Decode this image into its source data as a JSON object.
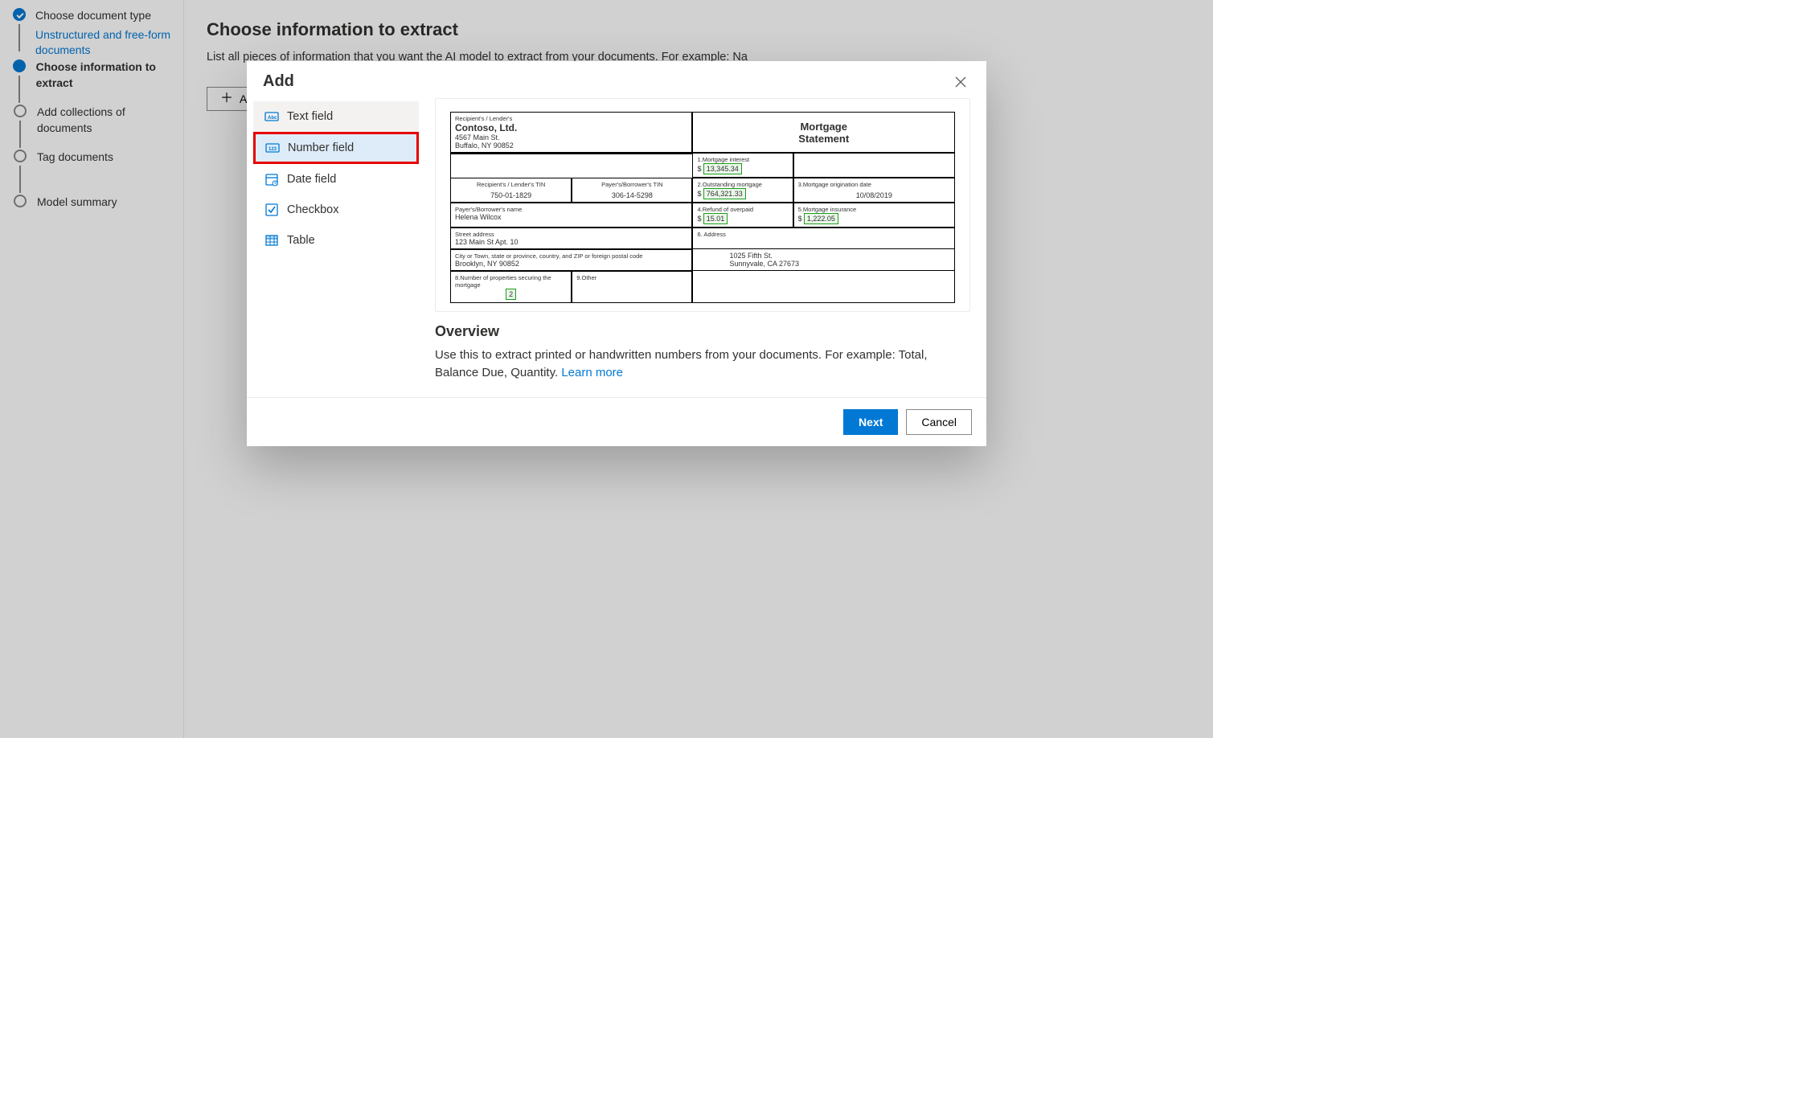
{
  "steps": {
    "s1_label": "Choose document type",
    "s1_sub": "Unstructured and free-form documents",
    "s2_label": "Choose information to extract",
    "s3_label": "Add collections of documents",
    "s4_label": "Tag documents",
    "s5_label": "Model summary"
  },
  "main": {
    "title": "Choose information to extract",
    "description": "List all pieces of information that you want the AI model to extract from your documents. For example: Na",
    "add_button": "Add"
  },
  "dialog": {
    "title": "Add",
    "types": {
      "text": "Text field",
      "number": "Number field",
      "date": "Date field",
      "checkbox": "Checkbox",
      "table": "Table"
    },
    "overview_heading": "Overview",
    "overview_text": "Use this to extract printed or handwritten numbers from your documents. For example: Total, Balance Due, Quantity. ",
    "learn_more": "Learn more",
    "next": "Next",
    "cancel": "Cancel"
  },
  "preview": {
    "recipient_lender_label": "Recipient's / Lender's",
    "company": "Contoso, Ltd.",
    "addr1": "4567 Main St.",
    "addr2": "Buffalo, NY 90852",
    "title_l1": "Mortgage",
    "title_l2": "Statement",
    "f1_label": "1.Mortgage interest",
    "f1_val": "13,345.34",
    "tin_lender_label": "Recipient's / Lender's TIN",
    "tin_lender_val": "750-01-1829",
    "tin_payer_label": "Payer's/Borrower's TIN",
    "tin_payer_val": "306-14-5298",
    "f2_label": "2.Outstanding mortgage",
    "f2_val": "764,321.33",
    "f3_label": "3.Mortgage origination date",
    "f3_val": "10/08/2019",
    "borrower_name_label": "Payer's/Borrower's name",
    "borrower_name": "Helena Wilcox",
    "f4_label": "4.Refund of overpaid",
    "f4_val": "15.01",
    "f5_label": "5.Mortgage insurance",
    "f5_val": "1,222.05",
    "street_label": "Street address",
    "street": "123 Main St Apt. 10",
    "f6_label": "6. Address",
    "city_label": "City or Town, state or province, country, and ZIP or foreign postal code",
    "city": "Brooklyn, NY 90852",
    "lender_addr1": "1025 Fifth St.",
    "lender_addr2": "Sunnyvale, CA 27673",
    "f8_label": "8.Number of properties securing the mortgage",
    "f8_val": "2",
    "f9_label": "9.Other"
  }
}
